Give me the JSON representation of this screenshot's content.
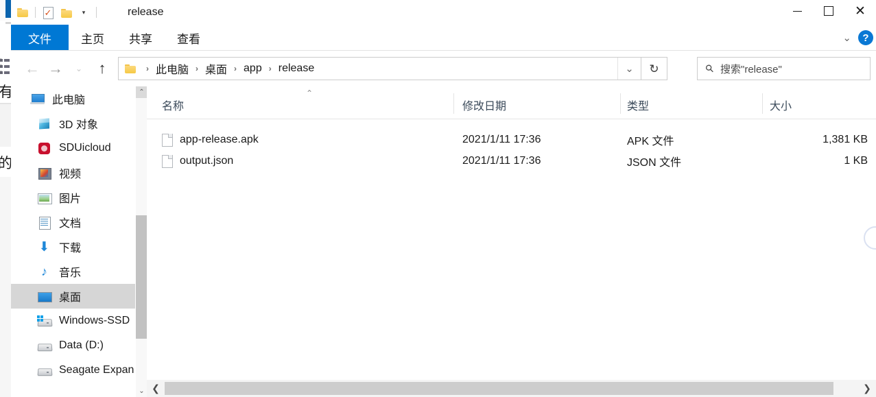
{
  "background_window": {
    "text_fragment_1": "有",
    "text_fragment_2": "的",
    "list_icon": "numbered-list-icon"
  },
  "window": {
    "title": "release",
    "quick_access": [
      {
        "name": "folder-icon",
        "label": ""
      },
      {
        "name": "properties-icon",
        "label": ""
      },
      {
        "name": "new-folder-icon",
        "label": ""
      },
      {
        "name": "customize-caret",
        "label": "▾"
      }
    ],
    "controls": {
      "minimize": "—",
      "maximize": "▢",
      "close": "✕"
    }
  },
  "ribbon": {
    "tabs": [
      {
        "label": "文件",
        "active": true
      },
      {
        "label": "主页",
        "active": false
      },
      {
        "label": "共享",
        "active": false
      },
      {
        "label": "查看",
        "active": false
      }
    ],
    "collapse_caret": "⌄",
    "help_label": "?",
    "accent_color": "#0078d4"
  },
  "toolbar": {
    "back": "←",
    "forward": "→",
    "recent": "⌄",
    "up": "↑",
    "address_dropdown": "⌄",
    "refresh": "↻"
  },
  "address": {
    "folder_icon": "folder-icon",
    "breadcrumbs": [
      "此电脑",
      "桌面",
      "app",
      "release"
    ],
    "separator": "›"
  },
  "search": {
    "icon": "search-icon",
    "placeholder": "搜索\"release\""
  },
  "sidebar": {
    "items": [
      {
        "label": "此电脑",
        "icon": "this-pc-icon",
        "selected": false,
        "root": true
      },
      {
        "label": "3D 对象",
        "icon": "3d-objects-icon",
        "selected": false
      },
      {
        "label": "SDUicloud",
        "icon": "sduicloud-icon",
        "selected": false
      },
      {
        "label": "视频",
        "icon": "videos-icon",
        "selected": false
      },
      {
        "label": "图片",
        "icon": "pictures-icon",
        "selected": false
      },
      {
        "label": "文档",
        "icon": "documents-icon",
        "selected": false
      },
      {
        "label": "下载",
        "icon": "downloads-icon",
        "selected": false
      },
      {
        "label": "音乐",
        "icon": "music-icon",
        "selected": false
      },
      {
        "label": "桌面",
        "icon": "desktop-icon",
        "selected": true
      },
      {
        "label": "Windows-SSD",
        "icon": "windows-drive-icon",
        "selected": false
      },
      {
        "label": "Data (D:)",
        "icon": "drive-icon",
        "selected": false
      },
      {
        "label": "Seagate Expan",
        "icon": "drive-icon",
        "selected": false
      }
    ],
    "scrollbar": {
      "up": "⌃",
      "down": "⌄"
    }
  },
  "filelist": {
    "columns": [
      {
        "label": "名称",
        "sorted": "asc",
        "sort_glyph": "⌃"
      },
      {
        "label": "修改日期",
        "sorted": ""
      },
      {
        "label": "类型",
        "sorted": ""
      },
      {
        "label": "大小",
        "sorted": ""
      }
    ],
    "rows": [
      {
        "icon": "file-icon",
        "name": "app-release.apk",
        "date": "2021/1/11 17:36",
        "type": "APK 文件",
        "size": "1,381 KB"
      },
      {
        "icon": "file-icon",
        "name": "output.json",
        "date": "2021/1/11 17:36",
        "type": "JSON 文件",
        "size": "1 KB"
      }
    ],
    "hscrollbar": {
      "left": "❮",
      "right": "❯"
    }
  }
}
